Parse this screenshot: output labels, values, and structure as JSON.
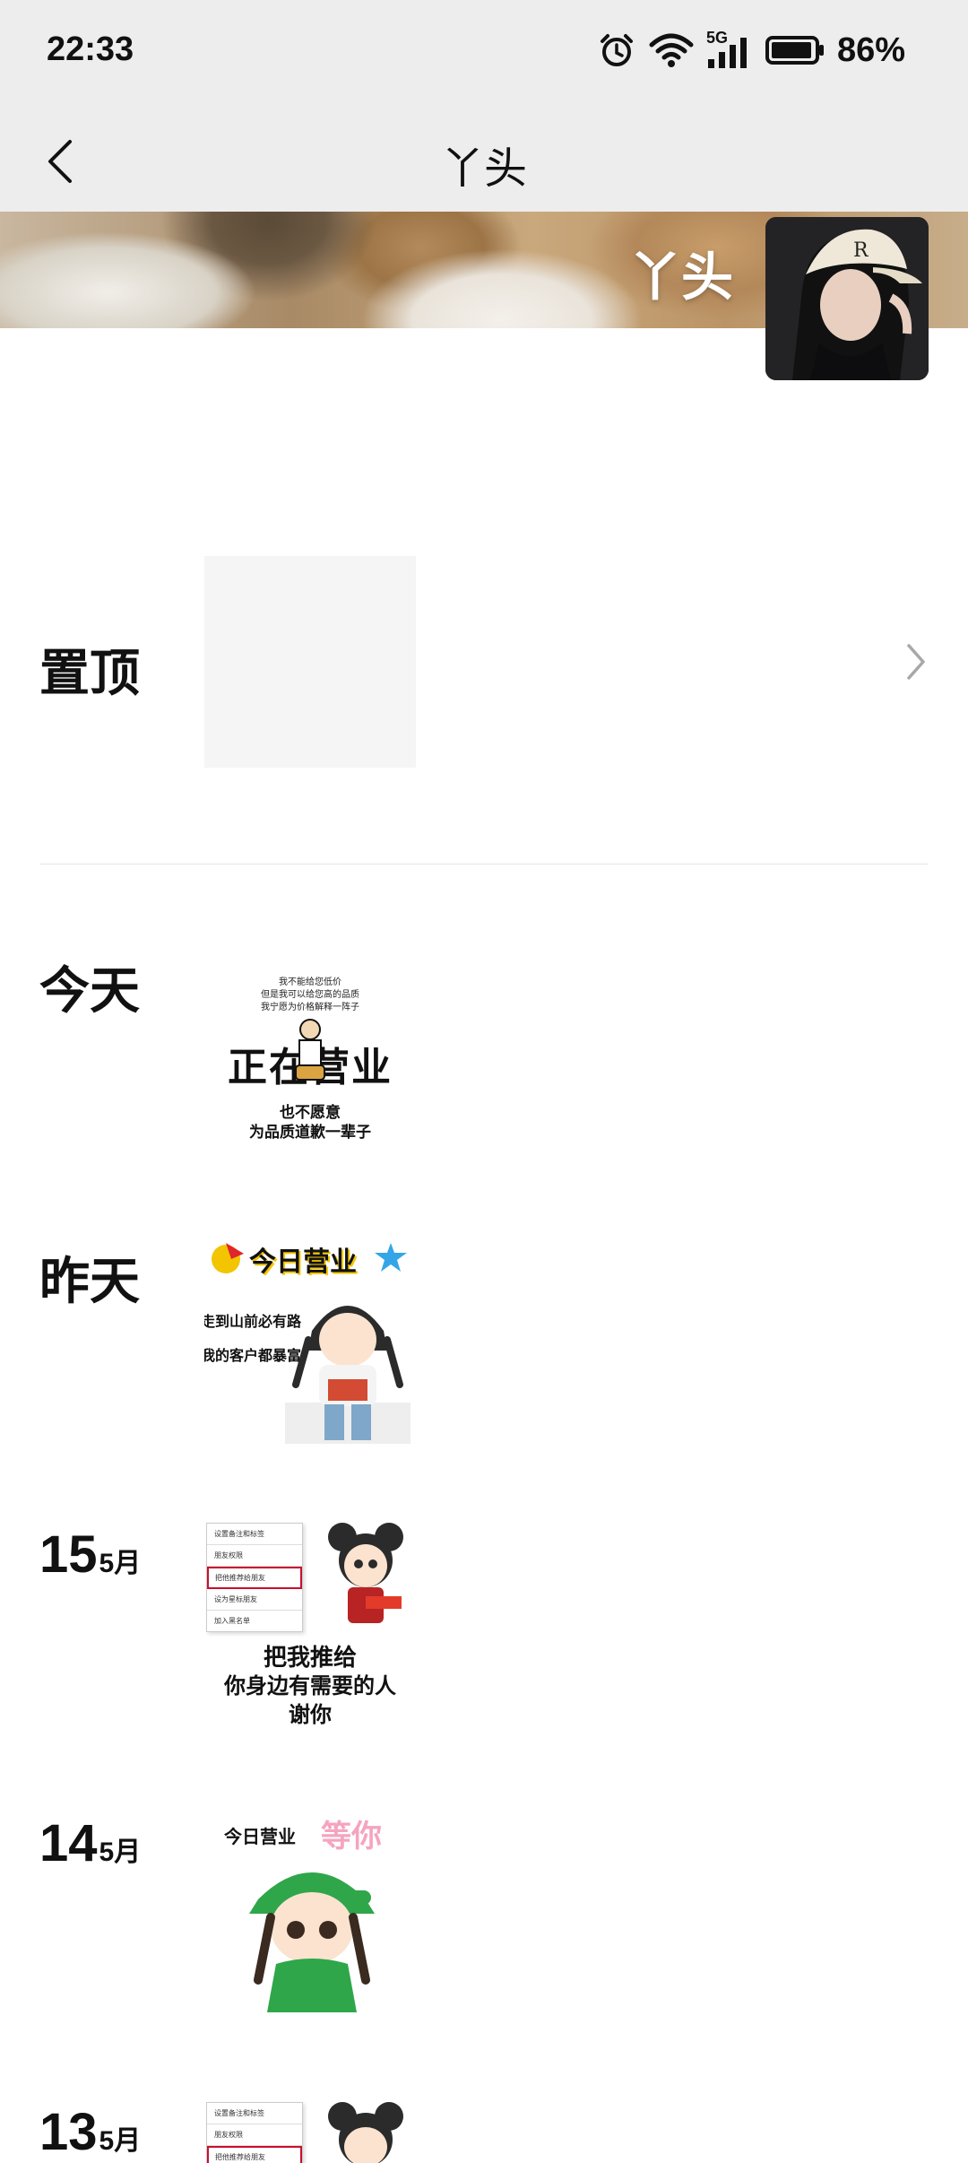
{
  "status": {
    "time": "22:33",
    "network": "5G",
    "battery": "86%"
  },
  "header": {
    "title": "丫头"
  },
  "cover": {
    "name": "丫头"
  },
  "pinned": {
    "label": "置顶"
  },
  "entries": [
    {
      "label": "今天",
      "text": {
        "small1": "我不能给您低价",
        "small2": "但是我可以给您高的品质",
        "small3": "我宁愿为价格解释一阵子",
        "main": "正在营业",
        "bottom1": "也不愿意",
        "bottom2": "为品质道歉一辈子"
      }
    },
    {
      "label": "昨天",
      "text": {
        "badge": "今日营业",
        "line1": "走到山前必有路",
        "line2": "我的客户都暴富"
      }
    },
    {
      "day": "15",
      "month": "5月",
      "text": {
        "menu1": "设置备注和标签",
        "menu2": "朋友权限",
        "menu3": "把他推荐给朋友",
        "menu4": "设为星标朋友",
        "menu5": "加入黑名单",
        "line1": "把我推给",
        "line2": "你身边有需要的人",
        "line3": "谢你"
      }
    },
    {
      "day": "14",
      "month": "5月",
      "text": {
        "top": "今日营业",
        "wait": "等你"
      }
    },
    {
      "day": "13",
      "month": "5月",
      "text": {
        "menu1": "设置备注和标签",
        "menu2": "朋友权限",
        "menu3": "把他推荐给朋友"
      }
    }
  ],
  "colors": {
    "bar_bg": "#ededed",
    "divider": "#e6e6e6",
    "accent_red": "#c8102e"
  }
}
